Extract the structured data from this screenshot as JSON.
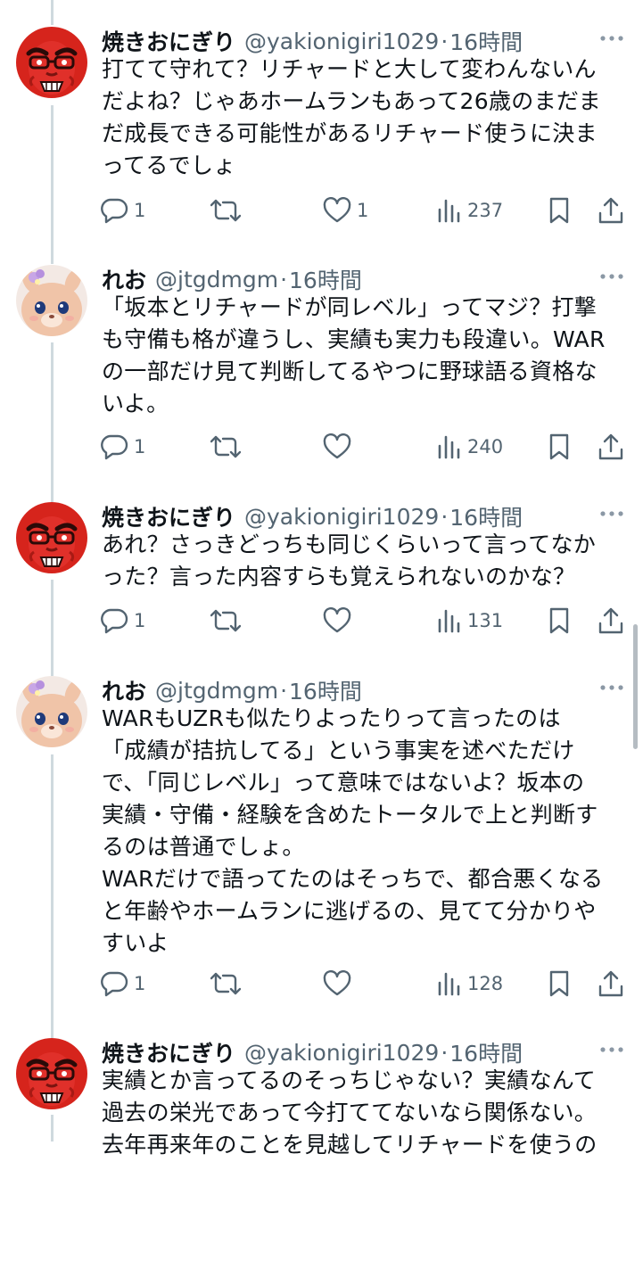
{
  "tweets": [
    {
      "author_name": "焼きおにぎり",
      "author_handle": "@yakionigiri1029",
      "separator": "·",
      "time": "16時間",
      "avatar": "red-angry-face",
      "text": "打てて守れて？リチャードと大して変わんないん\nだよね？じゃあホームランもあって26歳のまだま\nだ成長できる可能性があるリチャード使うに決ま\nってるでしょ",
      "replies": "1",
      "reposts": "",
      "likes": "1",
      "views": "237"
    },
    {
      "author_name": "れお",
      "author_handle": "@jtgdmgm",
      "separator": "·",
      "time": "16時間",
      "avatar": "pink-bunny-character",
      "text": "「坂本とリチャードが同レベル」ってマジ？打撃\nも守備も格が違うし、実績も実力も段違い。WAR\nの一部だけ見て判断してるやつに野球語る資格な\nいよ。",
      "replies": "1",
      "reposts": "",
      "likes": "",
      "views": "240"
    },
    {
      "author_name": "焼きおにぎり",
      "author_handle": "@yakionigiri1029",
      "separator": "·",
      "time": "16時間",
      "avatar": "red-angry-face",
      "text": "あれ？さっきどっちも同じくらいって言ってなか\nった？言った内容すらも覚えられないのかな？",
      "replies": "1",
      "reposts": "",
      "likes": "",
      "views": "131"
    },
    {
      "author_name": "れお",
      "author_handle": "@jtgdmgm",
      "separator": "·",
      "time": "16時間",
      "avatar": "pink-bunny-character",
      "text": "WARもUZRも似たりよったりって言ったのは\n「成績が拮抗してる」という事実を述べただけ\nで、「同じレベル」って意味ではないよ？坂本の\n実績・守備・経験を含めたトータルで上と判断す\nるのは普通でしょ。\nWARだけで語ってたのはそっちで、都合悪くなる\nと年齢やホームランに逃げるの、見てて分かりや\nすいよ",
      "replies": "1",
      "reposts": "",
      "likes": "",
      "views": "128"
    },
    {
      "author_name": "焼きおにぎり",
      "author_handle": "@yakionigiri1029",
      "separator": "·",
      "time": "16時間",
      "avatar": "red-angry-face",
      "text": "実績とか言ってるのそっちじゃない？実績なんて\n過去の栄光であって今打ててないなら関係ない。\n去年再来年のことを見越してリチャードを使うの",
      "replies": "",
      "reposts": "",
      "likes": "",
      "views": ""
    }
  ],
  "icons": {
    "reply": "reply-icon",
    "repost": "repost-icon",
    "like": "like-icon",
    "views": "views-icon",
    "bookmark": "bookmark-icon",
    "share": "share-icon",
    "more": "more-icon"
  },
  "colors": {
    "text": "#0f1419",
    "secondary": "#536471",
    "thread_line": "#cfd9de",
    "avatar_red": "#d6241c"
  }
}
